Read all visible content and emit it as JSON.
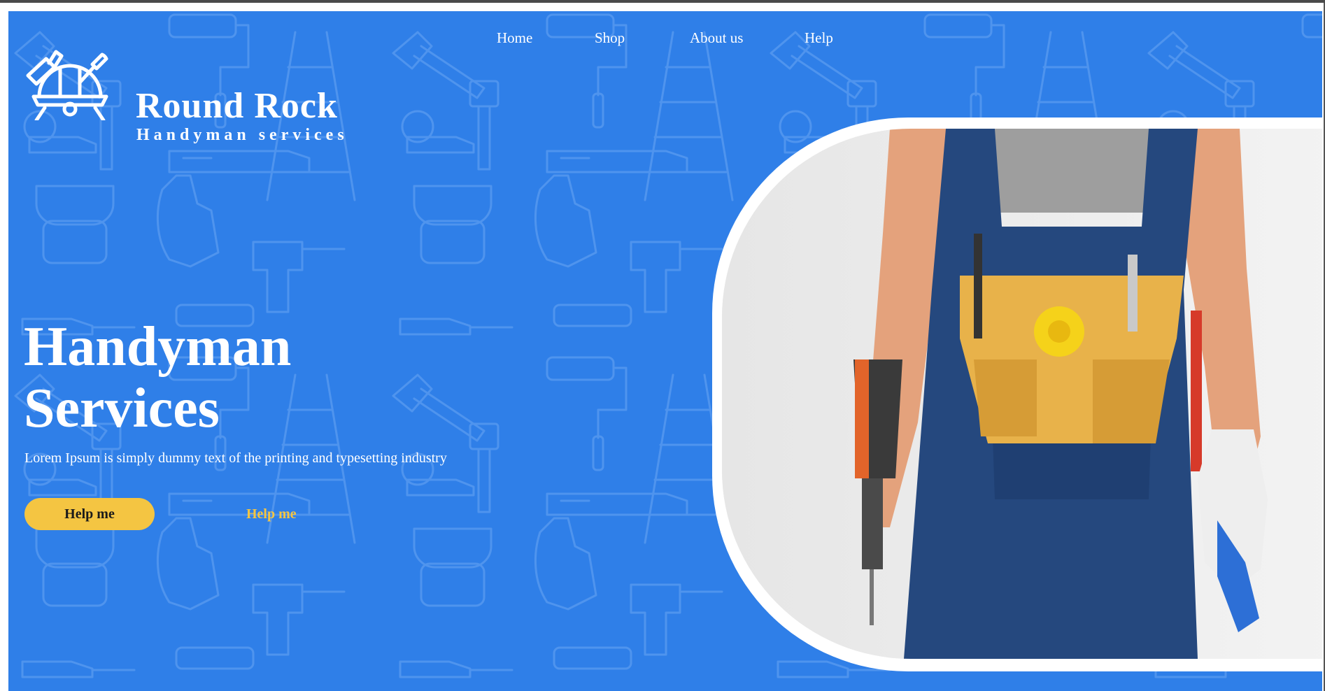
{
  "brand": {
    "name": "Round Rock",
    "subtitle": "Handyman services"
  },
  "nav": {
    "items": [
      {
        "label": "Home"
      },
      {
        "label": "Shop"
      },
      {
        "label": "About us"
      },
      {
        "label": "Help"
      }
    ]
  },
  "hero": {
    "headline_line1": "Handyman",
    "headline_line2": "Services",
    "tagline": "Lorem Ipsum is simply dummy text of the printing and typesetting industry",
    "primary_button": "Help me",
    "secondary_link": "Help me"
  },
  "colors": {
    "hero_background": "#2f7fe8",
    "accent": "#f4c542",
    "text": "#ffffff"
  },
  "icons": [
    "helmet-wrench-icon",
    "tool-pattern-icon"
  ]
}
